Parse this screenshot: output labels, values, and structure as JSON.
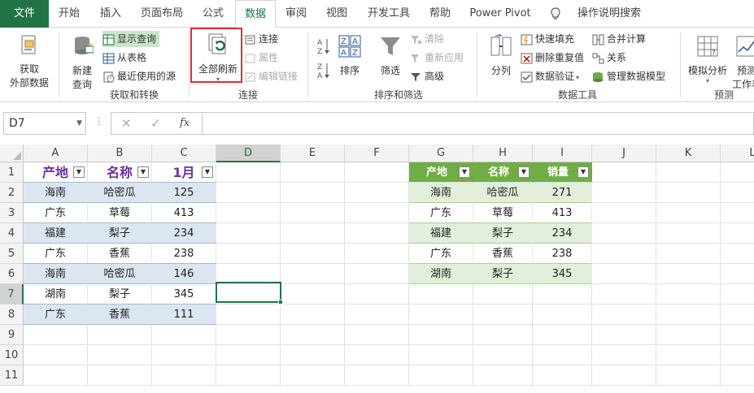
{
  "tabs": [
    {
      "label": "文件"
    },
    {
      "label": "开始"
    },
    {
      "label": "插入"
    },
    {
      "label": "页面布局"
    },
    {
      "label": "公式"
    },
    {
      "label": "数据"
    },
    {
      "label": "审阅"
    },
    {
      "label": "视图"
    },
    {
      "label": "开发工具"
    },
    {
      "label": "帮助"
    },
    {
      "label": "Power Pivot"
    },
    {
      "label": "操作说明搜索"
    }
  ],
  "ribbon": {
    "get_external": {
      "label1": "获取",
      "label2": "外部数据"
    },
    "new_query": {
      "label1": "新建",
      "label2": "查询"
    },
    "show_query": "显示查询",
    "from_table": "从表格",
    "recent_sources": "最近使用的源",
    "group_get_transform": "获取和转换",
    "refresh_all": "全部刷新",
    "connections": "连接",
    "properties": "属性",
    "edit_links": "编辑链接",
    "group_connections": "连接",
    "sort": "排序",
    "filter": "筛选",
    "clear": "清除",
    "reapply": "重新应用",
    "advanced": "高级",
    "group_sort_filter": "排序和筛选",
    "text_to_columns": "分列",
    "flash_fill": "快速填充",
    "remove_duplicates": "删除重复值",
    "data_validation": "数据验证",
    "consolidate": "合并计算",
    "relationships": "关系",
    "manage_model": "管理数据模型",
    "group_data_tools": "数据工具",
    "what_if": "模拟分析",
    "forecast_sheet": {
      "label1": "预测",
      "label2": "工作表"
    },
    "group_forecast": "预测"
  },
  "namebox": "D7",
  "columns": [
    "A",
    "B",
    "C",
    "D",
    "E",
    "F",
    "G",
    "H",
    "I",
    "J",
    "K",
    "L"
  ],
  "rows": [
    "1",
    "2",
    "3",
    "4",
    "5",
    "6",
    "7",
    "8",
    "9",
    "10",
    "11"
  ],
  "table1": {
    "headers": [
      "产地",
      "名称",
      "1月"
    ],
    "rows": [
      [
        "海南",
        "哈密瓜",
        "125"
      ],
      [
        "广东",
        "草莓",
        "413"
      ],
      [
        "福建",
        "梨子",
        "234"
      ],
      [
        "广东",
        "香蕉",
        "238"
      ],
      [
        "海南",
        "哈密瓜",
        "146"
      ],
      [
        "湖南",
        "梨子",
        "345"
      ],
      [
        "广东",
        "香蕉",
        "111"
      ]
    ]
  },
  "table2": {
    "headers": [
      "产地",
      "名称",
      "销量"
    ],
    "rows": [
      [
        "海南",
        "哈密瓜",
        "271"
      ],
      [
        "广东",
        "草莓",
        "413"
      ],
      [
        "福建",
        "梨子",
        "234"
      ],
      [
        "广东",
        "香蕉",
        "238"
      ],
      [
        "湖南",
        "梨子",
        "345"
      ]
    ]
  },
  "colors": {
    "accent": "#217346",
    "table_header_purple": "#7030a0",
    "table2_header": "#70ad47",
    "highlight": "#e52d2d"
  }
}
